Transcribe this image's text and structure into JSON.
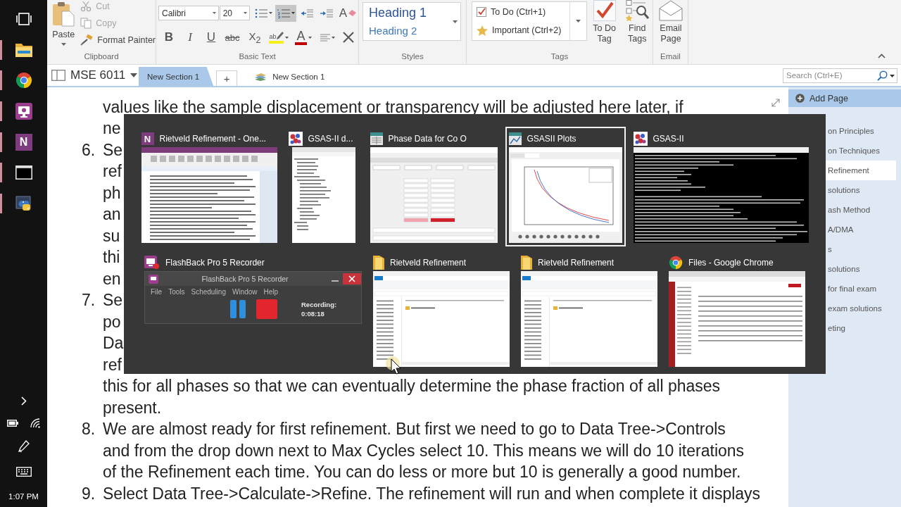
{
  "taskbar": {
    "apps": [
      {
        "kind": "folder",
        "running": true
      },
      {
        "kind": "browser",
        "running": true
      },
      {
        "kind": "recorder",
        "running": true
      },
      {
        "kind": "notes",
        "glyph": "N",
        "running": true
      },
      {
        "kind": "console",
        "running": true
      },
      {
        "kind": "script",
        "running": true
      }
    ],
    "clock": "1:07 PM"
  },
  "ribbon": {
    "clipboard": {
      "label": "Clipboard",
      "paste": "Paste",
      "commands": [
        {
          "kind": "cut",
          "text": "Cut",
          "disabled": true
        },
        {
          "kind": "copy",
          "text": "Copy",
          "disabled": true
        },
        {
          "kind": "painter",
          "text": "Format Painter",
          "disabled": false
        }
      ]
    },
    "basic_text": {
      "label": "Basic Text",
      "font": "Calibri",
      "size": "20",
      "row1": [
        {
          "kind": "bullets",
          "selected": false
        },
        {
          "kind": "numbering",
          "selected": true
        },
        {
          "kind": "outdent"
        },
        {
          "kind": "indent"
        },
        {
          "kind": "clear",
          "text": "A"
        }
      ],
      "row2": [
        {
          "kind": "bold",
          "text": "B",
          "selected": false
        },
        {
          "kind": "italic",
          "text": "I",
          "selected": false
        },
        {
          "kind": "underline",
          "text": "U",
          "selected": false
        },
        {
          "kind": "strike",
          "text": "abc",
          "selected": false
        },
        {
          "kind": "subscript",
          "text": "X$_{2}$",
          "selected": false
        },
        {
          "kind": "highlight",
          "text": "ab"
        },
        {
          "kind": "color",
          "text": "A"
        },
        {
          "kind": "align"
        },
        {
          "kind": "delete"
        }
      ]
    },
    "styles": {
      "label": "Styles",
      "items": [
        {
          "kind": "heading1",
          "text": "Heading 1"
        },
        {
          "kind": "heading2",
          "text": "Heading 2"
        }
      ]
    },
    "tags": {
      "label": "Tags",
      "gallery": [
        {
          "kind": "todo",
          "text": "To Do (Ctrl+1)"
        },
        {
          "kind": "important",
          "text": "Important (Ctrl+2)"
        }
      ],
      "buttons": [
        {
          "kind": "todo",
          "text": "To Do Tag"
        },
        {
          "kind": "find",
          "text": "Find Tags"
        }
      ]
    },
    "email": {
      "label": "Email",
      "buttons": [
        {
          "kind": "email",
          "text": "Email Page"
        }
      ]
    }
  },
  "notebook_bar": {
    "notebook": "MSE 6011",
    "tabs": [
      {
        "text": "New Section 1",
        "selected": true
      }
    ],
    "add_section": "+",
    "section_group": "New Section 1",
    "search": {
      "placeholder": "Search (Ctrl+E)"
    }
  },
  "page": {
    "lines": [
      {
        "text": "values like the sample displacement or transparency will be adjusted here later, if"
      },
      {
        "text": "ne"
      },
      {
        "marker": "6.",
        "text": "Se"
      },
      {
        "text": "ref"
      },
      {
        "text": "ph"
      },
      {
        "text": "an"
      },
      {
        "text": "su"
      },
      {
        "text": "thi"
      },
      {
        "text": "en"
      },
      {
        "marker": "7.",
        "text": "Se"
      },
      {
        "text": "po"
      },
      {
        "text": "Da"
      },
      {
        "text": "ref"
      },
      {
        "text": "this for all phases so that we can eventually determine the phase fraction of all phases"
      },
      {
        "text": "present."
      },
      {
        "marker": "8.",
        "text": "We are almost ready for first refinement. But first we need to go to Data Tree->Controls"
      },
      {
        "text": "and from the drop down next to Max Cycles select 10. This means we will do 10 iterations"
      },
      {
        "text": "of the Refinement each time. You can do less or more but 10 is generally a good number."
      },
      {
        "marker": "9.",
        "text": "Select Data Tree->Calculate->Refine. The refinement will run and when complete it displays"
      }
    ]
  },
  "pages": {
    "add": "Add Page",
    "items": [
      {
        "text": "on Principles",
        "selected": false
      },
      {
        "text": "on Techniques",
        "selected": false
      },
      {
        "text": "Refinement",
        "selected": true
      },
      {
        "text": "solutions",
        "selected": false
      },
      {
        "text": "ash Method",
        "selected": false
      },
      {
        "text": "A/DMA",
        "selected": false
      },
      {
        "text": "s",
        "selected": false
      },
      {
        "text": "solutions",
        "selected": false
      },
      {
        "text": "for final exam",
        "selected": false
      },
      {
        "text": "exam solutions",
        "selected": false
      },
      {
        "text": "eting",
        "selected": false
      }
    ]
  },
  "switcher": {
    "windows": [
      {
        "kind": "notes",
        "glyph": "N",
        "title": "Rietveld Refinement - One...",
        "selected": false
      },
      {
        "kind": "tree",
        "title": "GSAS-II d...",
        "selected": false
      },
      {
        "kind": "form",
        "title": "Phase Data for Co O",
        "selected": false
      },
      {
        "kind": "plot",
        "title": "GSASII Plots",
        "selected": true
      },
      {
        "kind": "console",
        "title": "GSAS-II",
        "selected": false
      },
      {
        "kind": "recorder",
        "title": "FlashBack Pro 5 Recorder",
        "selected": false,
        "window": {
          "title": "FlashBack Pro 5 Recorder",
          "menu": [
            "File",
            "Tools",
            "Scheduling",
            "Window",
            "Help"
          ],
          "status": "Recording:",
          "time": "0:08:18"
        }
      },
      {
        "kind": "folder",
        "title": "Rietveld Refinement",
        "selected": false
      },
      {
        "kind": "folder",
        "title": "Rietveld Refinement",
        "selected": false
      },
      {
        "kind": "browser",
        "title": "Files - Google Chrome",
        "selected": false
      }
    ]
  }
}
